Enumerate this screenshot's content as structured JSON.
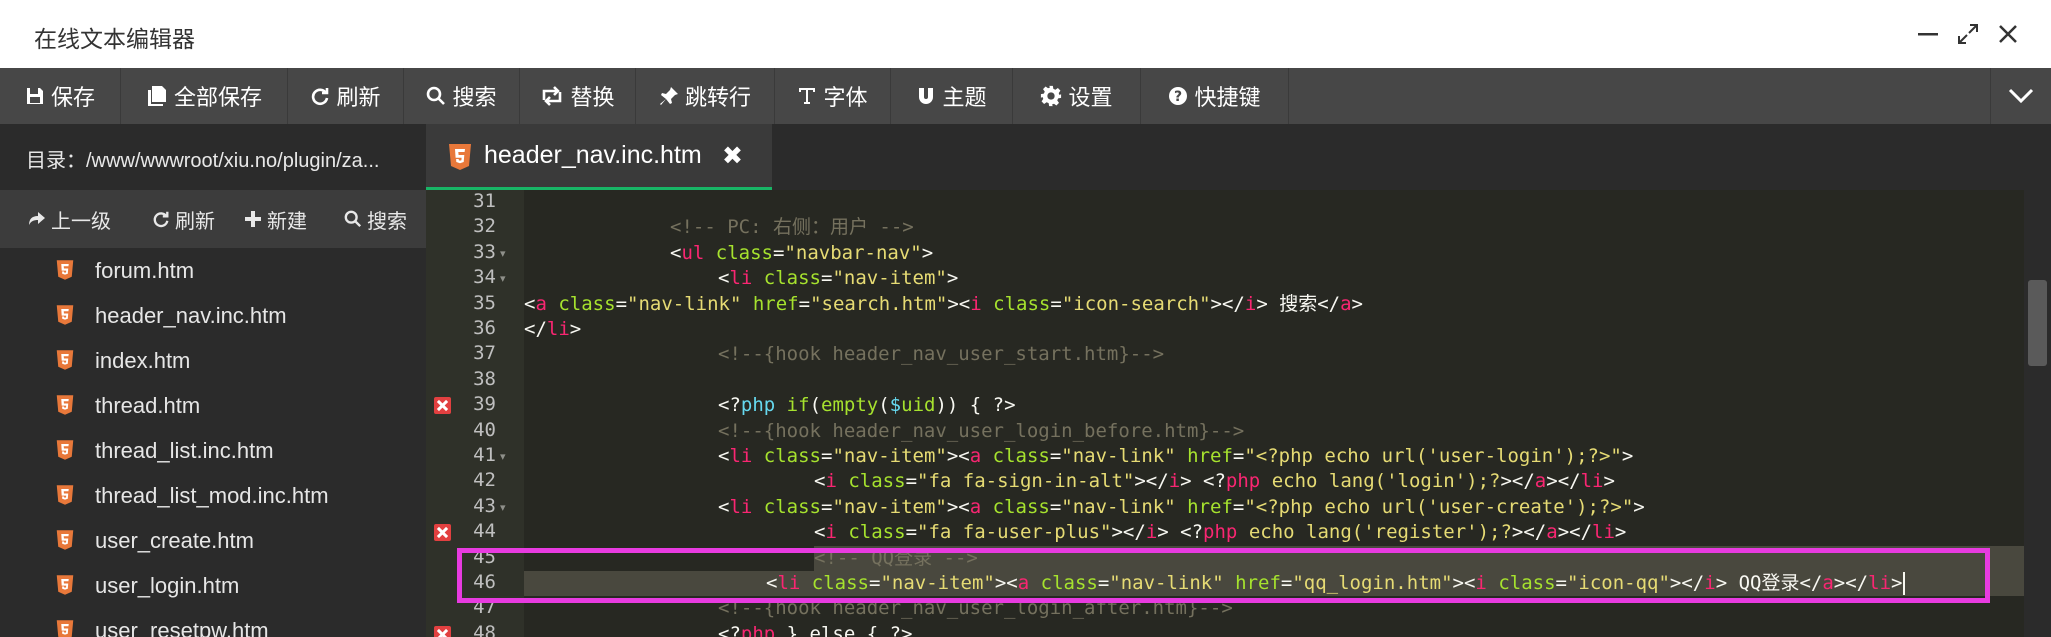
{
  "window": {
    "title": "在线文本编辑器",
    "controls": [
      {
        "name": "minimize",
        "glyph": "—"
      },
      {
        "name": "maximize",
        "glyph": "⤢"
      },
      {
        "name": "close",
        "glyph": "✕"
      }
    ]
  },
  "toolbar": {
    "items": [
      {
        "icon": "save-icon",
        "label": "保存"
      },
      {
        "icon": "save-all-icon",
        "label": "全部保存"
      },
      {
        "icon": "refresh-icon",
        "label": "刷新"
      },
      {
        "icon": "search-icon",
        "label": "搜索"
      },
      {
        "icon": "replace-icon",
        "label": "替换"
      },
      {
        "icon": "goto-line-icon",
        "label": "跳转行"
      },
      {
        "icon": "font-icon",
        "label": "字体"
      },
      {
        "icon": "theme-icon",
        "label": "主题"
      },
      {
        "icon": "gear-icon",
        "label": "设置"
      },
      {
        "icon": "help-icon",
        "label": "快捷键"
      }
    ],
    "collapse_icon": "chevron-down-icon"
  },
  "sidebar": {
    "directory": "目录：/www/wwwroot/xiu.no/plugin/za...",
    "actions": [
      {
        "icon": "up-icon",
        "label": "上一级"
      },
      {
        "icon": "refresh-icon",
        "label": "刷新"
      },
      {
        "icon": "plus-icon",
        "label": "新建"
      },
      {
        "icon": "search-icon",
        "label": "搜索"
      }
    ],
    "files": [
      "forum.htm",
      "header_nav.inc.htm",
      "index.htm",
      "thread.htm",
      "thread_list.inc.htm",
      "thread_list_mod.inc.htm",
      "user_create.htm",
      "user_login.htm",
      "user_resetpw.htm"
    ]
  },
  "tabs": [
    {
      "label": "header_nav.inc.htm",
      "close": "✖",
      "active": true
    }
  ],
  "editor": {
    "lines": [
      {
        "n": "31",
        "tokens": []
      },
      {
        "n": "32",
        "tokens": [
          [
            "cmt",
            "<!-- PC: 右侧：用户 -->"
          ]
        ]
      },
      {
        "n": "33",
        "fold": true,
        "tokens": [
          [
            "txt",
            "<"
          ],
          [
            "tag",
            "ul"
          ],
          [
            "txt",
            " "
          ],
          [
            "attr",
            "class"
          ],
          [
            "txt",
            "="
          ],
          [
            "str",
            "\"navbar-nav\""
          ],
          [
            "txt",
            ">"
          ]
        ]
      },
      {
        "n": "34",
        "fold": true,
        "tokens": [
          [
            "txt",
            "<"
          ],
          [
            "tag",
            "li"
          ],
          [
            "txt",
            " "
          ],
          [
            "attr",
            "class"
          ],
          [
            "txt",
            "="
          ],
          [
            "str",
            "\"nav-item\""
          ],
          [
            "txt",
            ">"
          ]
        ]
      },
      {
        "n": "35",
        "tokens": [
          [
            "txt",
            "<"
          ],
          [
            "tag",
            "a"
          ],
          [
            "txt",
            " "
          ],
          [
            "attr",
            "class"
          ],
          [
            "txt",
            "="
          ],
          [
            "str",
            "\"nav-link\""
          ],
          [
            "txt",
            " "
          ],
          [
            "attr",
            "href"
          ],
          [
            "txt",
            "="
          ],
          [
            "str",
            "\"search.htm\""
          ],
          [
            "txt",
            "><"
          ],
          [
            "tag",
            "i"
          ],
          [
            "txt",
            " "
          ],
          [
            "attr",
            "class"
          ],
          [
            "txt",
            "="
          ],
          [
            "str",
            "\"icon-search\""
          ],
          [
            "txt",
            "></"
          ],
          [
            "tag",
            "i"
          ],
          [
            "txt",
            "> 搜索</"
          ],
          [
            "tag",
            "a"
          ],
          [
            "txt",
            ">"
          ]
        ]
      },
      {
        "n": "36",
        "tokens": [
          [
            "txt",
            "</"
          ],
          [
            "tag",
            "li"
          ],
          [
            "txt",
            ">"
          ]
        ]
      },
      {
        "n": "37",
        "tokens": [
          [
            "cmt",
            "<!--{hook header_nav_user_start.htm}-->"
          ]
        ]
      },
      {
        "n": "38",
        "tokens": []
      },
      {
        "n": "39",
        "err": true,
        "tokens": [
          [
            "txt",
            "<?"
          ],
          [
            "php",
            "php"
          ],
          [
            "txt",
            " "
          ],
          [
            "attr",
            "if"
          ],
          [
            "txt",
            "("
          ],
          [
            "attr",
            "empty"
          ],
          [
            "txt",
            "("
          ],
          [
            "php",
            "$"
          ],
          [
            "attr",
            "uid"
          ],
          [
            "txt",
            ")) { ?>"
          ]
        ]
      },
      {
        "n": "40",
        "tokens": [
          [
            "cmt",
            "<!--{hook header_nav_user_login_before.htm}-->"
          ]
        ]
      },
      {
        "n": "41",
        "fold": true,
        "tokens": [
          [
            "txt",
            "<"
          ],
          [
            "tag",
            "li"
          ],
          [
            "txt",
            " "
          ],
          [
            "attr",
            "class"
          ],
          [
            "txt",
            "="
          ],
          [
            "str",
            "\"nav-item\""
          ],
          [
            "txt",
            "><"
          ],
          [
            "tag",
            "a"
          ],
          [
            "txt",
            " "
          ],
          [
            "attr",
            "class"
          ],
          [
            "txt",
            "="
          ],
          [
            "str",
            "\"nav-link\""
          ],
          [
            "txt",
            " "
          ],
          [
            "attr",
            "href"
          ],
          [
            "txt",
            "="
          ],
          [
            "str",
            "\"<?php echo url('user-login');?>\""
          ],
          [
            "txt",
            ">"
          ]
        ]
      },
      {
        "n": "42",
        "tokens": [
          [
            "txt",
            "<"
          ],
          [
            "tag",
            "i"
          ],
          [
            "txt",
            " "
          ],
          [
            "attr",
            "class"
          ],
          [
            "txt",
            "="
          ],
          [
            "str",
            "\"fa fa-sign-in-alt\""
          ],
          [
            "txt",
            "></"
          ],
          [
            "tag",
            "i"
          ],
          [
            "txt",
            "> <?"
          ],
          [
            "tag",
            "php"
          ],
          [
            "txt",
            " "
          ],
          [
            "str",
            "echo lang('login');?"
          ],
          [
            "txt",
            "></"
          ],
          [
            "tag",
            "a"
          ],
          [
            "txt",
            "></"
          ],
          [
            "tag",
            "li"
          ],
          [
            "txt",
            ">"
          ]
        ]
      },
      {
        "n": "43",
        "fold": true,
        "tokens": [
          [
            "txt",
            "<"
          ],
          [
            "tag",
            "li"
          ],
          [
            "txt",
            " "
          ],
          [
            "attr",
            "class"
          ],
          [
            "txt",
            "="
          ],
          [
            "str",
            "\"nav-item\""
          ],
          [
            "txt",
            "><"
          ],
          [
            "tag",
            "a"
          ],
          [
            "txt",
            " "
          ],
          [
            "attr",
            "class"
          ],
          [
            "txt",
            "="
          ],
          [
            "str",
            "\"nav-link\""
          ],
          [
            "txt",
            " "
          ],
          [
            "attr",
            "href"
          ],
          [
            "txt",
            "="
          ],
          [
            "str",
            "\"<?php echo url('user-create');?>\""
          ],
          [
            "txt",
            ">"
          ]
        ]
      },
      {
        "n": "44",
        "err": true,
        "tokens": [
          [
            "txt",
            "<"
          ],
          [
            "tag",
            "i"
          ],
          [
            "txt",
            " "
          ],
          [
            "attr",
            "class"
          ],
          [
            "txt",
            "="
          ],
          [
            "str",
            "\"fa fa-user-plus\""
          ],
          [
            "txt",
            "></"
          ],
          [
            "tag",
            "i"
          ],
          [
            "txt",
            "> <?"
          ],
          [
            "tag",
            "php"
          ],
          [
            "txt",
            " "
          ],
          [
            "str",
            "echo lang('register');?"
          ],
          [
            "txt",
            "></"
          ],
          [
            "tag",
            "a"
          ],
          [
            "txt",
            "></"
          ],
          [
            "tag",
            "li"
          ],
          [
            "txt",
            ">"
          ]
        ]
      },
      {
        "n": "45",
        "tokens": [
          [
            "cmt",
            "<!-- QQ登录 -->"
          ]
        ]
      },
      {
        "n": "46",
        "tokens": [
          [
            "txt",
            "<"
          ],
          [
            "tag",
            "li"
          ],
          [
            "txt",
            " "
          ],
          [
            "attr",
            "class"
          ],
          [
            "txt",
            "="
          ],
          [
            "str",
            "\"nav-item\""
          ],
          [
            "txt",
            "><"
          ],
          [
            "tag",
            "a"
          ],
          [
            "txt",
            " "
          ],
          [
            "attr",
            "class"
          ],
          [
            "txt",
            "="
          ],
          [
            "str",
            "\"nav-link\""
          ],
          [
            "txt",
            " "
          ],
          [
            "attr",
            "href"
          ],
          [
            "txt",
            "="
          ],
          [
            "str",
            "\"qq_login.htm\""
          ],
          [
            "txt",
            "><"
          ],
          [
            "tag",
            "i"
          ],
          [
            "txt",
            " "
          ],
          [
            "attr",
            "class"
          ],
          [
            "txt",
            "="
          ],
          [
            "str",
            "\"icon-qq\""
          ],
          [
            "txt",
            "></"
          ],
          [
            "tag",
            "i"
          ],
          [
            "txt",
            "> QQ登录</"
          ],
          [
            "tag",
            "a"
          ],
          [
            "txt",
            "></"
          ],
          [
            "tag",
            "li"
          ],
          [
            "txt",
            ">"
          ]
        ]
      },
      {
        "n": "47",
        "tokens": [
          [
            "cmt",
            "<!--{hook header_nav_user_login_after.htm}-->"
          ]
        ]
      },
      {
        "n": "48",
        "err": true,
        "tokens": [
          [
            "txt",
            "<?"
          ],
          [
            "tag",
            "php"
          ],
          [
            "txt",
            " } else { ?>"
          ]
        ]
      }
    ]
  },
  "colors": {
    "accent": "#18b566",
    "annotation": "#e83be0",
    "error": "#e24040"
  }
}
